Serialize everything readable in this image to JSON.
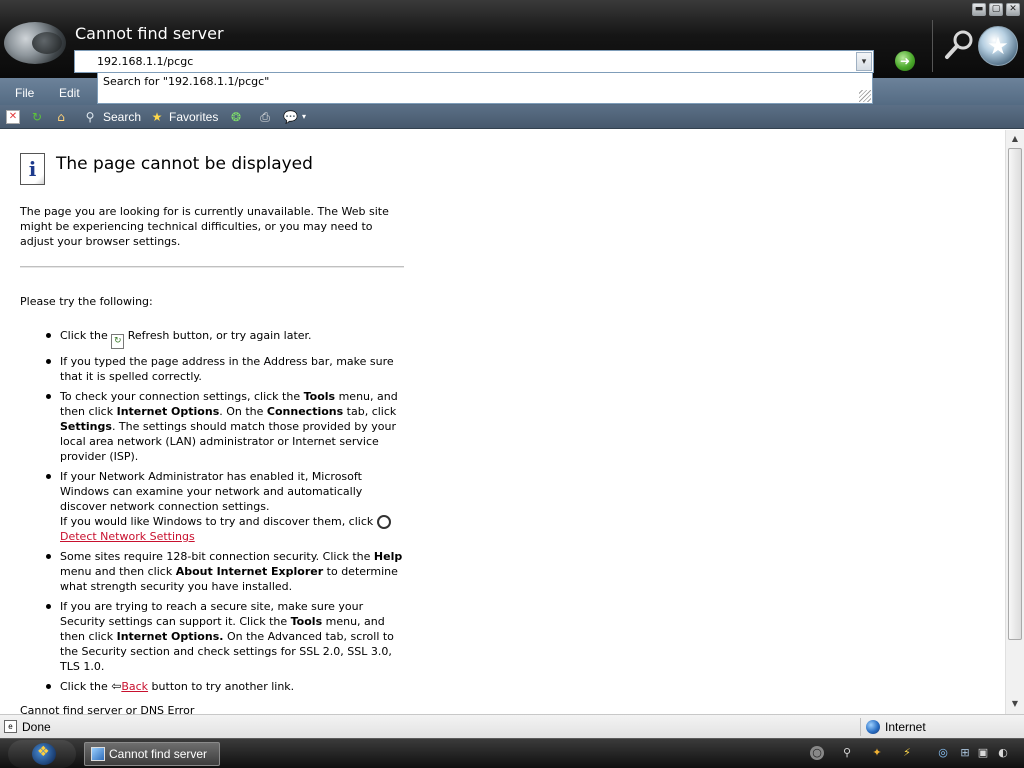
{
  "window": {
    "title": "Cannot find server",
    "address": "192.168.1.1/pcgc",
    "autocomplete": "Search for \"192.168.1.1/pcgc\"",
    "controls": [
      "minimize",
      "maximize",
      "close"
    ]
  },
  "menu": {
    "items": [
      {
        "label": "File"
      },
      {
        "label": "Edit"
      }
    ]
  },
  "toolbar": {
    "search_label": "Search",
    "favorites_label": "Favorites",
    "icons": [
      "stop-icon",
      "refresh-icon",
      "home-icon",
      "search-icon",
      "favorites-star-icon",
      "media-icon",
      "print-icon",
      "messenger-icon"
    ]
  },
  "content": {
    "title": "The page cannot be displayed",
    "intro": "The page you are looking for is currently unavailable. The Web site might be experiencing technical difficulties, or you may need to adjust your browser settings.",
    "try_heading": "Please try the following:",
    "suggestions": {
      "s1_a": "Click the",
      "s1_b": "Refresh button, or try again later.",
      "s2": "If you typed the page address in the Address bar, make sure that it is spelled correctly.",
      "s3_a": "To check your connection settings, click the",
      "s3_tools": "Tools",
      "s3_b": "menu, and then click",
      "s3_options": "Internet Options",
      "s3_c": ". On the",
      "s3_connections": "Connections",
      "s3_d": "tab, click",
      "s3_settings": "Settings",
      "s3_e": ". The settings should match those provided by your local area network (LAN) administrator or Internet service provider (ISP).",
      "s4_a": "If your Network Administrator has enabled it, Microsoft Windows can examine your network and automatically discover network connection settings.",
      "s4_b": "If you would like Windows to try and discover them, click",
      "s4_link": "Detect Network Settings",
      "s5_a": "Some sites require 128-bit connection security. Click the",
      "s5_help": "Help",
      "s5_b": "menu and then click",
      "s5_about": "About Internet Explorer",
      "s5_c": "to determine what strength security you have installed.",
      "s6_a": "If you are trying to reach a secure site, make sure your Security settings can support it. Click the",
      "s6_tools": "Tools",
      "s6_b": "menu, and then click",
      "s6_options": "Internet Options.",
      "s6_c": "On the Advanced tab, scroll to the Security section and check settings for SSL 2.0, SSL 3.0, TLS 1.0.",
      "s7_a": "Click the",
      "s7_link": "Back",
      "s7_b": "button to try another link."
    },
    "footer": "Cannot find server or DNS Error"
  },
  "status": {
    "text": "Done",
    "zone": "Internet"
  },
  "taskbar": {
    "task_label": "Cannot find server"
  },
  "colors": {
    "link": "#c8102e",
    "menubar": "#607690",
    "titlebar": "#151515"
  }
}
